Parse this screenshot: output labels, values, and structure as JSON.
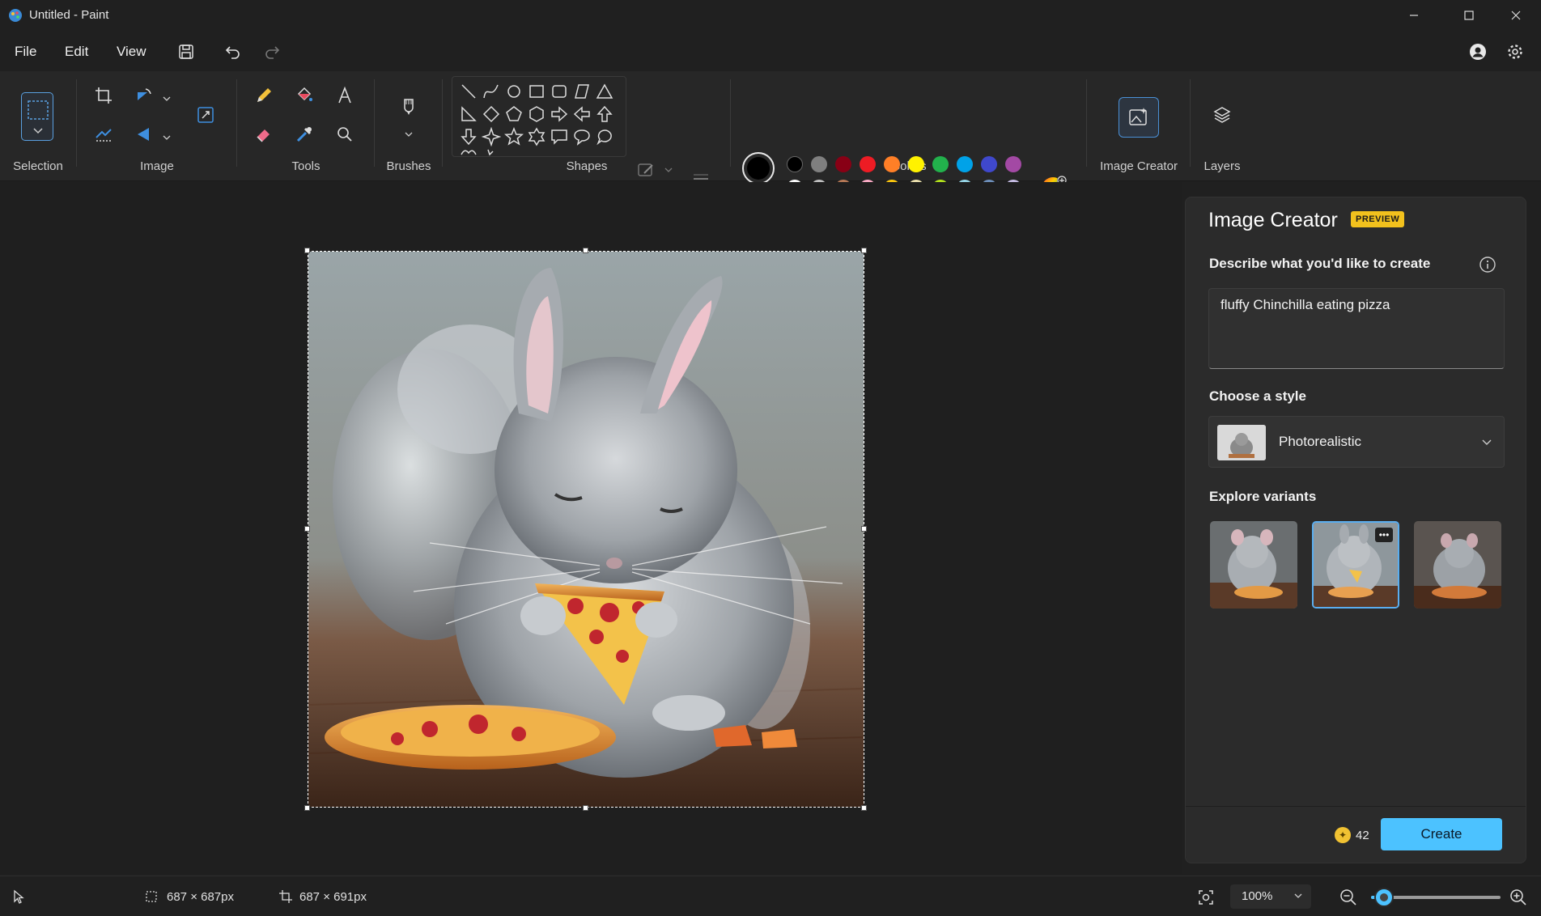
{
  "window": {
    "title": "Untitled - Paint"
  },
  "menu": {
    "file": "File",
    "edit": "Edit",
    "view": "View"
  },
  "ribbon": {
    "groups": {
      "selection": "Selection",
      "image": "Image",
      "tools": "Tools",
      "brushes": "Brushes",
      "shapes": "Shapes",
      "colors": "Colors",
      "image_creator": "Image Creator",
      "layers": "Layers"
    },
    "palette_row1": [
      "#000000",
      "#7f7f7f",
      "#880015",
      "#ed1c24",
      "#ff7f27",
      "#fff200",
      "#22b14c",
      "#00a2e8",
      "#3f48cc",
      "#a349a4"
    ],
    "palette_row2": [
      "#ffffff",
      "#c3c3c3",
      "#b97a57",
      "#ffaec9",
      "#ffc90e",
      "#efe4b0",
      "#b5e61d",
      "#99d9ea",
      "#7092be",
      "#c8bfe7"
    ],
    "primary_color": "#000000",
    "secondary_color": "#ffffff"
  },
  "panel": {
    "title": "Image Creator",
    "badge": "PREVIEW",
    "describe_label": "Describe what you'd like to create",
    "prompt_text": "fluffy Chinchilla eating pizza",
    "style_label": "Choose a style",
    "style_value": "Photorealistic",
    "variants_label": "Explore variants",
    "credits": "42",
    "create_button": "Create"
  },
  "status": {
    "selection_size": "687 × 687px",
    "canvas_size": "687 × 691px",
    "zoom": "100%",
    "zoom_slider_fraction": 0.1
  }
}
